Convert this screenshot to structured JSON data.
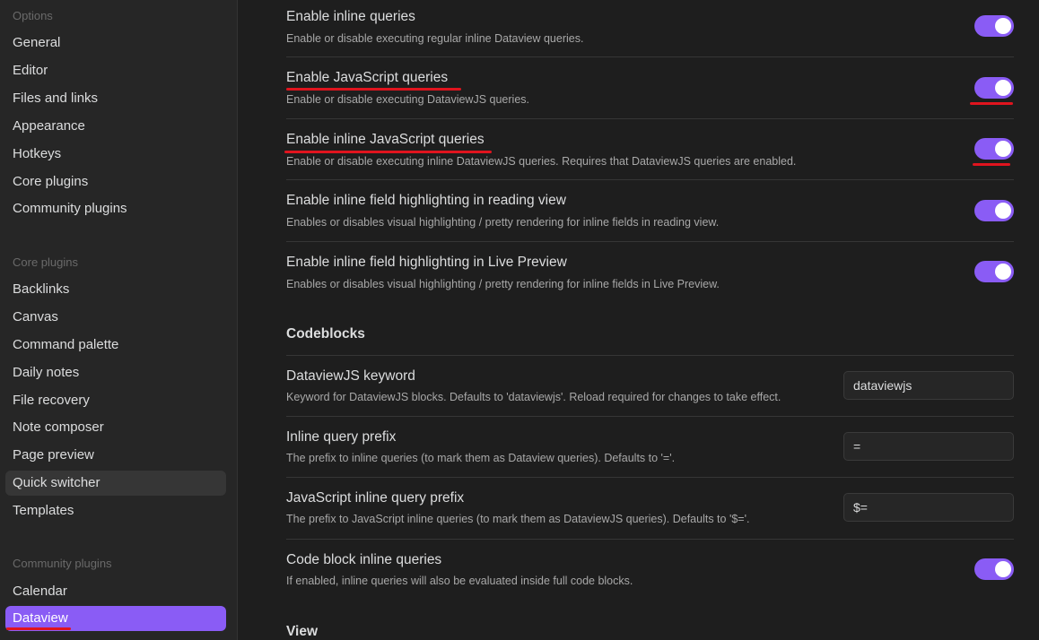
{
  "sidebar": {
    "options_heading": "Options",
    "options": [
      "General",
      "Editor",
      "Files and links",
      "Appearance",
      "Hotkeys",
      "Core plugins",
      "Community plugins"
    ],
    "core_heading": "Core plugins",
    "core": [
      "Backlinks",
      "Canvas",
      "Command palette",
      "Daily notes",
      "File recovery",
      "Note composer",
      "Page preview",
      "Quick switcher",
      "Templates"
    ],
    "community_heading": "Community plugins",
    "community": [
      "Calendar",
      "Dataview"
    ]
  },
  "settings": [
    {
      "name": "Enable inline queries",
      "desc": "Enable or disable executing regular inline Dataview queries.",
      "enabled": true
    },
    {
      "name": "Enable JavaScript queries",
      "desc": "Enable or disable executing DataviewJS queries.",
      "enabled": true
    },
    {
      "name": "Enable inline JavaScript queries",
      "desc": "Enable or disable executing inline DataviewJS queries. Requires that DataviewJS queries are enabled.",
      "enabled": true
    },
    {
      "name": "Enable inline field highlighting in reading view",
      "desc": "Enables or disables visual highlighting / pretty rendering for inline fields in reading view.",
      "enabled": true
    },
    {
      "name": "Enable inline field highlighting in Live Preview",
      "desc": "Enables or disables visual highlighting / pretty rendering for inline fields in Live Preview.",
      "enabled": true
    }
  ],
  "codeblocks": {
    "title": "Codeblocks",
    "items": [
      {
        "name": "DataviewJS keyword",
        "desc": "Keyword for DataviewJS blocks. Defaults to 'dataviewjs'. Reload required for changes to take effect.",
        "value": "dataviewjs"
      },
      {
        "name": "Inline query prefix",
        "desc": "The prefix to inline queries (to mark them as Dataview queries). Defaults to '='.",
        "value": "="
      },
      {
        "name": "JavaScript inline query prefix",
        "desc": "The prefix to JavaScript inline queries (to mark them as DataviewJS queries). Defaults to '$='.",
        "value": "$="
      }
    ],
    "toggle_item": {
      "name": "Code block inline queries",
      "desc": "If enabled, inline queries will also be evaluated inside full code blocks.",
      "enabled": true
    }
  },
  "view_title": "View",
  "colors": {
    "accent": "#8a5cf5",
    "annotation": "#e0141e"
  }
}
